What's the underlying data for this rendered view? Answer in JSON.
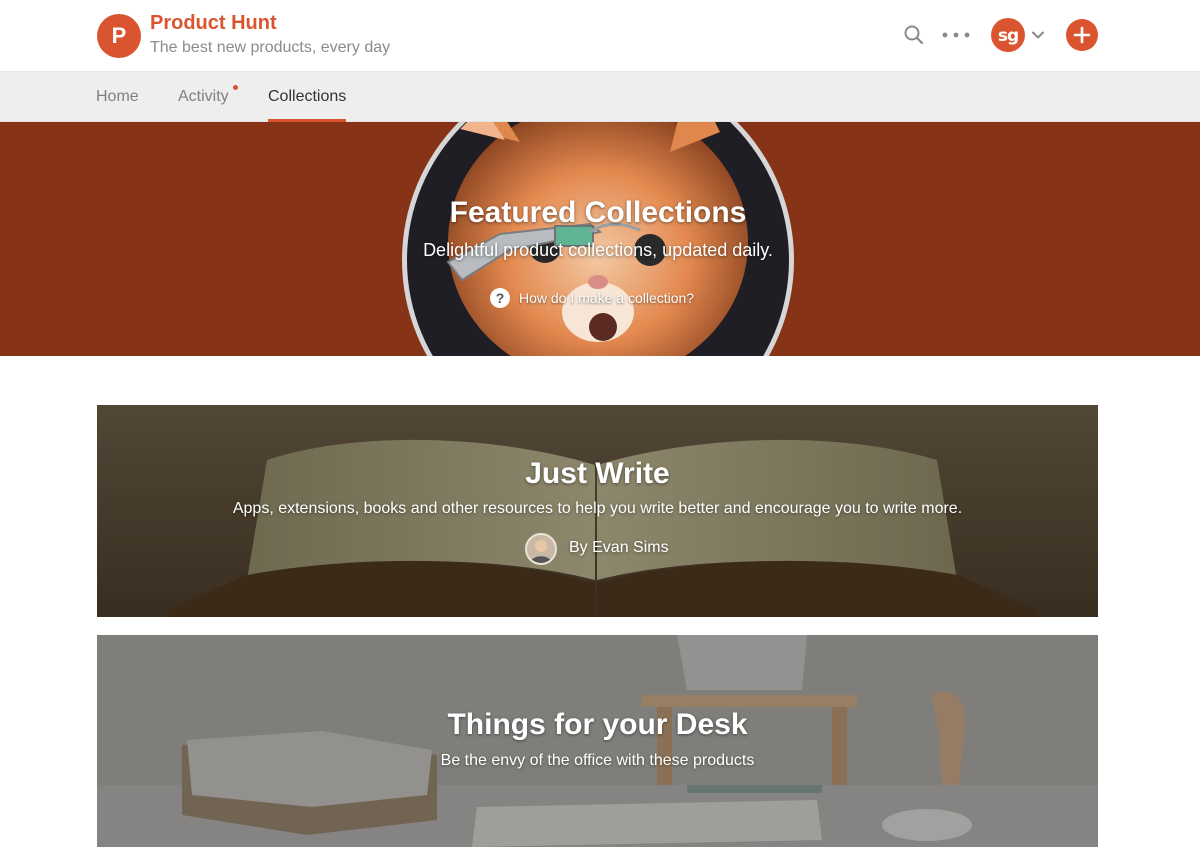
{
  "header": {
    "logo_letter": "P",
    "brand_name": "Product Hunt",
    "tagline": "The best new products, every day",
    "search_icon": "search-icon",
    "more_icon": "ellipsis-icon",
    "avatar_initials": "sg",
    "post_icon": "plus-icon"
  },
  "nav": {
    "tabs": [
      {
        "label": "Home",
        "active": false
      },
      {
        "label": "Activity",
        "active": false,
        "has_notification": true
      },
      {
        "label": "Collections",
        "active": true
      }
    ]
  },
  "hero": {
    "title": "Featured Collections",
    "subtitle": "Delightful product collections, updated daily.",
    "help_icon": "?",
    "help_link": "How do I make a collection?"
  },
  "collections": [
    {
      "title": "Just Write",
      "description": "Apps, extensions, books and other resources to help you write better and encourage you to write more.",
      "author": "By Evan Sims"
    },
    {
      "title": "Things for your Desk",
      "description": "Be the envy of the office with these products"
    }
  ],
  "colors": {
    "brand": "#da552f",
    "hero_background": "#863317"
  }
}
